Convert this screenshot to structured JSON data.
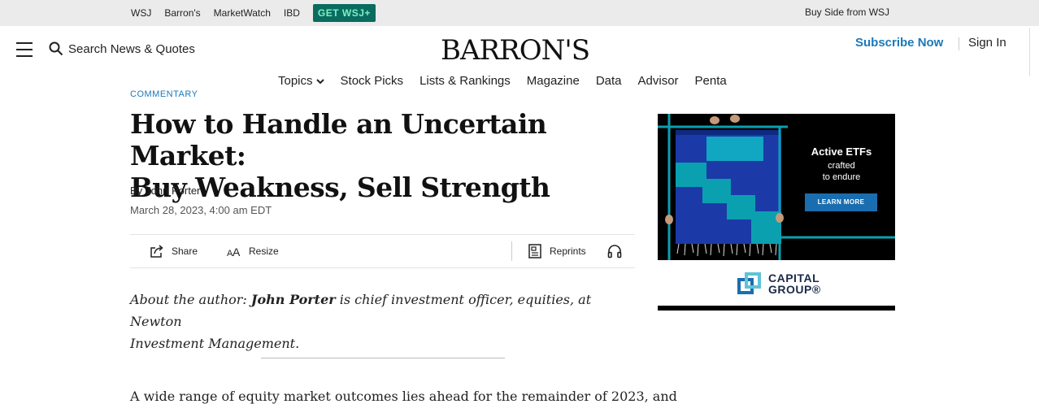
{
  "topbar": {
    "links": [
      "WSJ",
      "Barron's",
      "MarketWatch",
      "IBD"
    ],
    "cta": "GET WSJ+",
    "right_link": "Buy Side from WSJ"
  },
  "header": {
    "search_label": "Search News & Quotes",
    "logo": "BARRON'S",
    "subscribe": "Subscribe Now",
    "signin": "Sign In"
  },
  "nav": [
    "Topics",
    "Stock Picks",
    "Lists & Rankings",
    "Magazine",
    "Data",
    "Advisor",
    "Penta"
  ],
  "article": {
    "kicker": "COMMENTARY",
    "headline_line1": "How to Handle an Uncertain Market:",
    "headline_line2": "Buy Weakness, Sell Strength",
    "byline_prefix": "By",
    "author": "John Porter",
    "date": "March 28, 2023, 4:00 am EDT",
    "tools": {
      "share": "Share",
      "resize": "Resize",
      "reprints": "Reprints"
    },
    "about_prefix": "About the author:",
    "about_author": "John Porter",
    "about_rest": "is chief investment officer, equities, at Newton",
    "about_line2": "Investment Management.",
    "body_first_line": "A wide range of equity market outcomes lies ahead for the remainder of 2023, and"
  },
  "ad": {
    "title": "Active ETFs",
    "sub_line1": "crafted",
    "sub_line2": "to endure",
    "button": "LEARN MORE",
    "brand_line1": "CAPITAL",
    "brand_line2": "GROUP®"
  },
  "colors": {
    "accent_blue": "#1a7ab8",
    "cta_bg": "#0a6b5f",
    "cta_text": "#7ff0c3",
    "ad_teal": "#0aa0b0"
  }
}
